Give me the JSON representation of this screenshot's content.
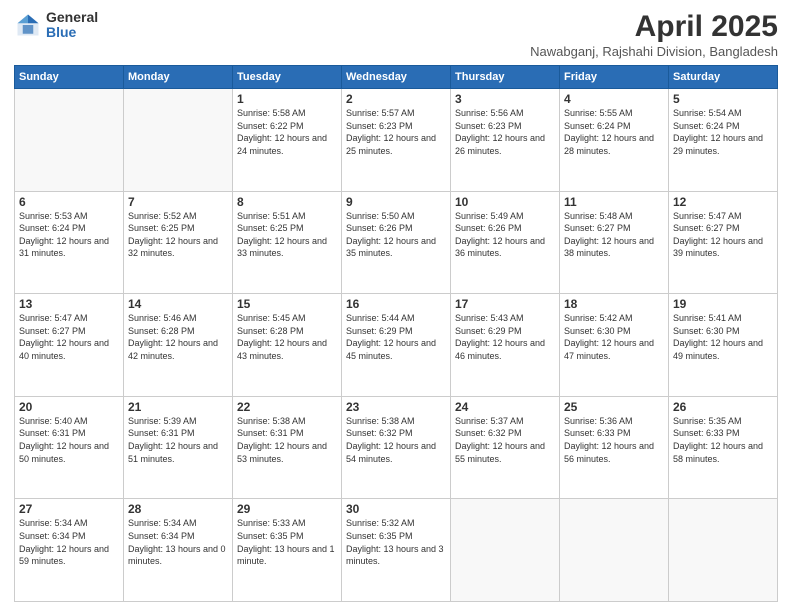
{
  "logo": {
    "general": "General",
    "blue": "Blue"
  },
  "header": {
    "month_year": "April 2025",
    "location": "Nawabganj, Rajshahi Division, Bangladesh"
  },
  "weekdays": [
    "Sunday",
    "Monday",
    "Tuesday",
    "Wednesday",
    "Thursday",
    "Friday",
    "Saturday"
  ],
  "weeks": [
    [
      {
        "num": "",
        "sunrise": "",
        "sunset": "",
        "daylight": ""
      },
      {
        "num": "",
        "sunrise": "",
        "sunset": "",
        "daylight": ""
      },
      {
        "num": "1",
        "sunrise": "Sunrise: 5:58 AM",
        "sunset": "Sunset: 6:22 PM",
        "daylight": "Daylight: 12 hours and 24 minutes."
      },
      {
        "num": "2",
        "sunrise": "Sunrise: 5:57 AM",
        "sunset": "Sunset: 6:23 PM",
        "daylight": "Daylight: 12 hours and 25 minutes."
      },
      {
        "num": "3",
        "sunrise": "Sunrise: 5:56 AM",
        "sunset": "Sunset: 6:23 PM",
        "daylight": "Daylight: 12 hours and 26 minutes."
      },
      {
        "num": "4",
        "sunrise": "Sunrise: 5:55 AM",
        "sunset": "Sunset: 6:24 PM",
        "daylight": "Daylight: 12 hours and 28 minutes."
      },
      {
        "num": "5",
        "sunrise": "Sunrise: 5:54 AM",
        "sunset": "Sunset: 6:24 PM",
        "daylight": "Daylight: 12 hours and 29 minutes."
      }
    ],
    [
      {
        "num": "6",
        "sunrise": "Sunrise: 5:53 AM",
        "sunset": "Sunset: 6:24 PM",
        "daylight": "Daylight: 12 hours and 31 minutes."
      },
      {
        "num": "7",
        "sunrise": "Sunrise: 5:52 AM",
        "sunset": "Sunset: 6:25 PM",
        "daylight": "Daylight: 12 hours and 32 minutes."
      },
      {
        "num": "8",
        "sunrise": "Sunrise: 5:51 AM",
        "sunset": "Sunset: 6:25 PM",
        "daylight": "Daylight: 12 hours and 33 minutes."
      },
      {
        "num": "9",
        "sunrise": "Sunrise: 5:50 AM",
        "sunset": "Sunset: 6:26 PM",
        "daylight": "Daylight: 12 hours and 35 minutes."
      },
      {
        "num": "10",
        "sunrise": "Sunrise: 5:49 AM",
        "sunset": "Sunset: 6:26 PM",
        "daylight": "Daylight: 12 hours and 36 minutes."
      },
      {
        "num": "11",
        "sunrise": "Sunrise: 5:48 AM",
        "sunset": "Sunset: 6:27 PM",
        "daylight": "Daylight: 12 hours and 38 minutes."
      },
      {
        "num": "12",
        "sunrise": "Sunrise: 5:47 AM",
        "sunset": "Sunset: 6:27 PM",
        "daylight": "Daylight: 12 hours and 39 minutes."
      }
    ],
    [
      {
        "num": "13",
        "sunrise": "Sunrise: 5:47 AM",
        "sunset": "Sunset: 6:27 PM",
        "daylight": "Daylight: 12 hours and 40 minutes."
      },
      {
        "num": "14",
        "sunrise": "Sunrise: 5:46 AM",
        "sunset": "Sunset: 6:28 PM",
        "daylight": "Daylight: 12 hours and 42 minutes."
      },
      {
        "num": "15",
        "sunrise": "Sunrise: 5:45 AM",
        "sunset": "Sunset: 6:28 PM",
        "daylight": "Daylight: 12 hours and 43 minutes."
      },
      {
        "num": "16",
        "sunrise": "Sunrise: 5:44 AM",
        "sunset": "Sunset: 6:29 PM",
        "daylight": "Daylight: 12 hours and 45 minutes."
      },
      {
        "num": "17",
        "sunrise": "Sunrise: 5:43 AM",
        "sunset": "Sunset: 6:29 PM",
        "daylight": "Daylight: 12 hours and 46 minutes."
      },
      {
        "num": "18",
        "sunrise": "Sunrise: 5:42 AM",
        "sunset": "Sunset: 6:30 PM",
        "daylight": "Daylight: 12 hours and 47 minutes."
      },
      {
        "num": "19",
        "sunrise": "Sunrise: 5:41 AM",
        "sunset": "Sunset: 6:30 PM",
        "daylight": "Daylight: 12 hours and 49 minutes."
      }
    ],
    [
      {
        "num": "20",
        "sunrise": "Sunrise: 5:40 AM",
        "sunset": "Sunset: 6:31 PM",
        "daylight": "Daylight: 12 hours and 50 minutes."
      },
      {
        "num": "21",
        "sunrise": "Sunrise: 5:39 AM",
        "sunset": "Sunset: 6:31 PM",
        "daylight": "Daylight: 12 hours and 51 minutes."
      },
      {
        "num": "22",
        "sunrise": "Sunrise: 5:38 AM",
        "sunset": "Sunset: 6:31 PM",
        "daylight": "Daylight: 12 hours and 53 minutes."
      },
      {
        "num": "23",
        "sunrise": "Sunrise: 5:38 AM",
        "sunset": "Sunset: 6:32 PM",
        "daylight": "Daylight: 12 hours and 54 minutes."
      },
      {
        "num": "24",
        "sunrise": "Sunrise: 5:37 AM",
        "sunset": "Sunset: 6:32 PM",
        "daylight": "Daylight: 12 hours and 55 minutes."
      },
      {
        "num": "25",
        "sunrise": "Sunrise: 5:36 AM",
        "sunset": "Sunset: 6:33 PM",
        "daylight": "Daylight: 12 hours and 56 minutes."
      },
      {
        "num": "26",
        "sunrise": "Sunrise: 5:35 AM",
        "sunset": "Sunset: 6:33 PM",
        "daylight": "Daylight: 12 hours and 58 minutes."
      }
    ],
    [
      {
        "num": "27",
        "sunrise": "Sunrise: 5:34 AM",
        "sunset": "Sunset: 6:34 PM",
        "daylight": "Daylight: 12 hours and 59 minutes."
      },
      {
        "num": "28",
        "sunrise": "Sunrise: 5:34 AM",
        "sunset": "Sunset: 6:34 PM",
        "daylight": "Daylight: 13 hours and 0 minutes."
      },
      {
        "num": "29",
        "sunrise": "Sunrise: 5:33 AM",
        "sunset": "Sunset: 6:35 PM",
        "daylight": "Daylight: 13 hours and 1 minute."
      },
      {
        "num": "30",
        "sunrise": "Sunrise: 5:32 AM",
        "sunset": "Sunset: 6:35 PM",
        "daylight": "Daylight: 13 hours and 3 minutes."
      },
      {
        "num": "",
        "sunrise": "",
        "sunset": "",
        "daylight": ""
      },
      {
        "num": "",
        "sunrise": "",
        "sunset": "",
        "daylight": ""
      },
      {
        "num": "",
        "sunrise": "",
        "sunset": "",
        "daylight": ""
      }
    ]
  ]
}
